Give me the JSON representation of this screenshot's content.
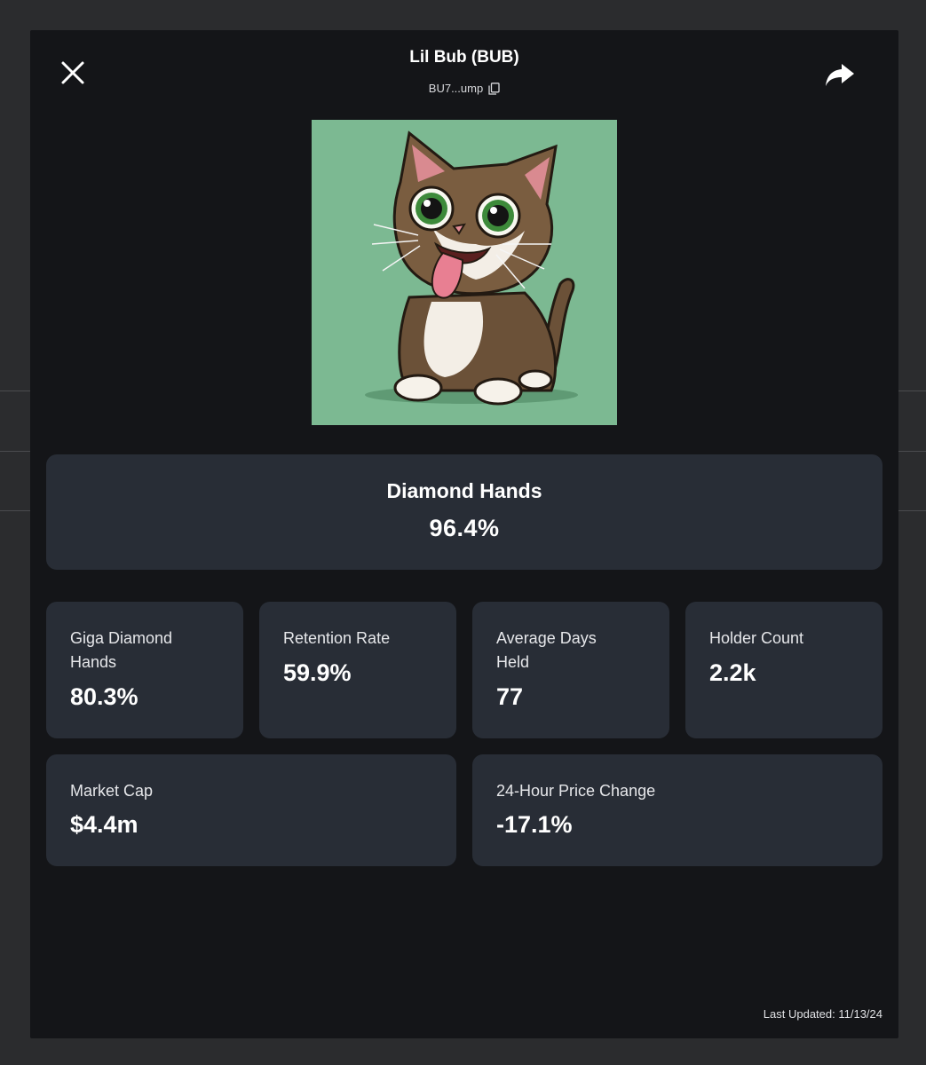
{
  "token": {
    "name": "Lil Bub (BUB)",
    "address": "BU7...ump"
  },
  "hero": {
    "label": "Diamond Hands",
    "value": "96.4%"
  },
  "stats": [
    {
      "label": "Giga Diamond Hands",
      "value": "80.3%"
    },
    {
      "label": "Retention Rate",
      "value": "59.9%"
    },
    {
      "label": "Average Days Held",
      "value": "77"
    },
    {
      "label": "Holder Count",
      "value": "2.2k"
    }
  ],
  "wide_stats": [
    {
      "label": "Market Cap",
      "value": "$4.4m"
    },
    {
      "label": "24-Hour Price Change",
      "value": "-17.1%"
    }
  ],
  "footer": {
    "last_updated": "Last Updated: 11/13/24"
  },
  "icons": {
    "close": "close-icon",
    "share": "share-icon",
    "copy": "copy-icon"
  },
  "colors": {
    "modal_bg": "#141518",
    "card_bg": "#282d36",
    "image_bg": "#7cb992"
  }
}
